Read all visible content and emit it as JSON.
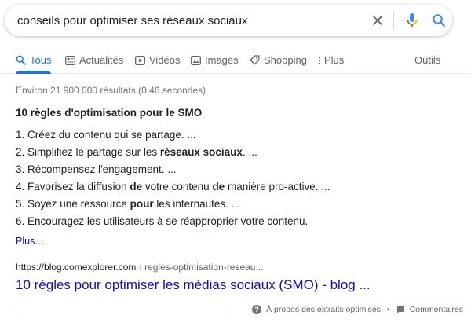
{
  "search": {
    "query": "conseils pour optimiser ses réseaux sociaux",
    "icons": {
      "clear": "close-icon",
      "mic": "microphone-icon",
      "submit": "search-icon"
    }
  },
  "tabs": [
    {
      "label": "Tous",
      "icon": "search-icon",
      "active": true
    },
    {
      "label": "Actualités",
      "icon": "news-icon"
    },
    {
      "label": "Vidéos",
      "icon": "video-icon"
    },
    {
      "label": "Images",
      "icon": "image-icon"
    },
    {
      "label": "Shopping",
      "icon": "tag-icon"
    },
    {
      "label": "Plus",
      "icon": "more-vert-icon"
    }
  ],
  "tools_label": "Outils",
  "stats": "Environ 21 900 000 résultats (0,46 secondes)",
  "featured_snippet": {
    "title": "10 règles d'optimisation pour le SMO",
    "items": [
      {
        "n": "1.",
        "before": "Créez du contenu qui se partage. ..."
      },
      {
        "n": "2.",
        "before": "Simplifiez le partage sur les ",
        "bold": "réseaux sociaux",
        "after": ". ..."
      },
      {
        "n": "3.",
        "before": "Récompensez l'engagement. ..."
      },
      {
        "n": "4.",
        "before": "Favorisez la diffusion ",
        "bold": "de",
        "mid": " votre contenu ",
        "bold2": "de",
        "after": " manière pro-active. ..."
      },
      {
        "n": "5.",
        "before": "Soyez une ressource ",
        "bold": "pour",
        "after": " les internautes. ..."
      },
      {
        "n": "6.",
        "before": "Encouragez les utilisateurs à se réapproprier votre contenu."
      }
    ],
    "more_label": "Plus…"
  },
  "result": {
    "url_domain": "https://blog.comexplorer.com",
    "url_path": " › regles-optimisation-reseau...",
    "title": "10 règles pour optimiser les médias sociaux (SMO) - blog ..."
  },
  "footer": {
    "about_label": "À propos des extraits optimisés",
    "separator": "•",
    "feedback_label": "Commentaires"
  },
  "colors": {
    "accent": "#1a73e8",
    "link": "#1a0dab",
    "text": "#202124",
    "muted": "#70757a"
  }
}
